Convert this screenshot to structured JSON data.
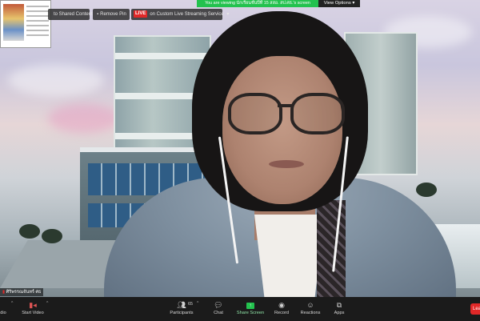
{
  "banner": {
    "viewing_text": "You are viewing นักเรียนชั้นปีที่ 15 สสอ. สป.ศธ.'s screen",
    "view_options": "View Options"
  },
  "topbar": {
    "shared_content": "to Shared Content",
    "remove_pin": "Remove Pin",
    "live_badge": "LIVE",
    "live_service": "on Custom Live Streaming Service"
  },
  "video": {
    "name_tag": "ศิริพรรณจันทร์ ศธ"
  },
  "toolbar": {
    "audio_label": "dio",
    "video_label": "Start Video",
    "participants_label": "Participants",
    "participants_count": "65",
    "chat_label": "Chat",
    "share_label": "Share Screen",
    "record_label": "Record",
    "reactions_label": "Reactions",
    "apps_label": "Apps",
    "leave_label": "Lea"
  },
  "icons": {
    "participants": "people-icon",
    "chat": "chat-icon",
    "share": "share-screen-icon",
    "record": "record-icon",
    "reactions": "smiley-icon",
    "apps": "apps-icon"
  },
  "colors": {
    "live_red": "#e02828",
    "share_green": "#23c24e",
    "toolbar_bg": "#1b1b1b"
  }
}
